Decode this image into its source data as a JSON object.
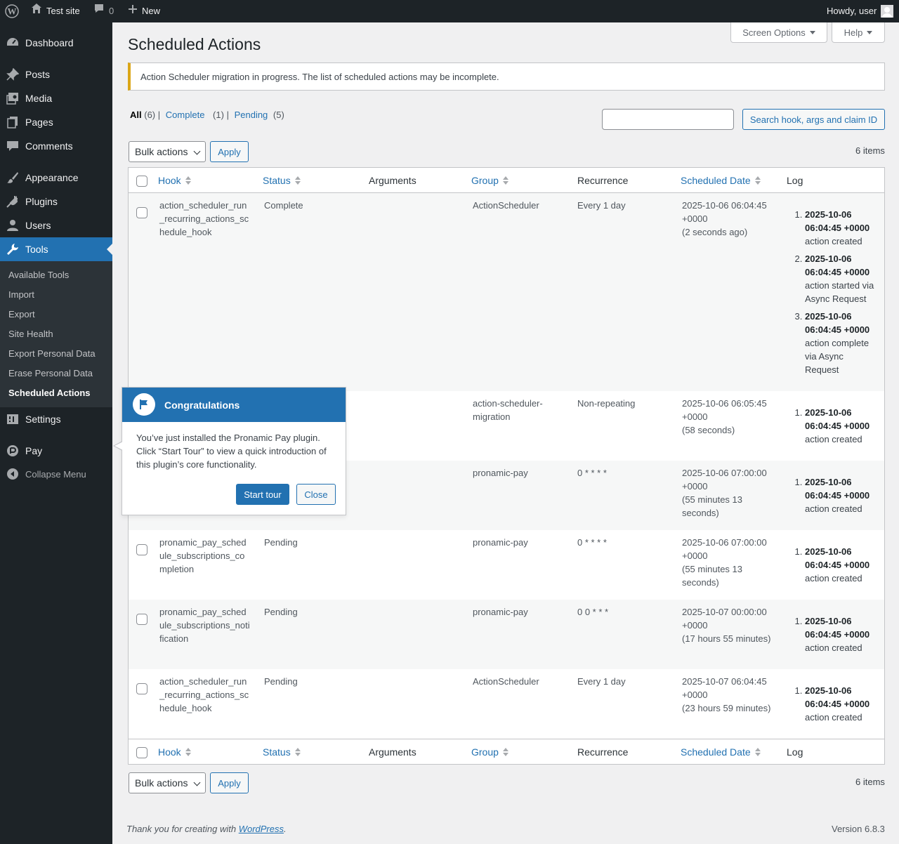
{
  "admin_bar": {
    "site_name": "Test site",
    "comments_count": "0",
    "new_label": "New",
    "howdy": "Howdy, user"
  },
  "sidebar": {
    "items": [
      {
        "label": "Dashboard",
        "icon": "dashboard-icon"
      },
      {
        "label": "Posts",
        "icon": "pin-icon"
      },
      {
        "label": "Media",
        "icon": "media-icon"
      },
      {
        "label": "Pages",
        "icon": "pages-icon"
      },
      {
        "label": "Comments",
        "icon": "comment-icon"
      },
      {
        "label": "Appearance",
        "icon": "brush-icon"
      },
      {
        "label": "Plugins",
        "icon": "plug-icon"
      },
      {
        "label": "Users",
        "icon": "user-icon"
      },
      {
        "label": "Tools",
        "icon": "wrench-icon"
      },
      {
        "label": "Settings",
        "icon": "settings-icon"
      },
      {
        "label": "Pay",
        "icon": "pay-icon"
      },
      {
        "label": "Collapse Menu",
        "icon": "collapse-icon"
      }
    ],
    "submenu": [
      "Available Tools",
      "Import",
      "Export",
      "Site Health",
      "Export Personal Data",
      "Erase Personal Data",
      "Scheduled Actions"
    ]
  },
  "screen_options": "Screen Options",
  "help": "Help",
  "page_title": "Scheduled Actions",
  "notice": "Action Scheduler migration in progress. The list of scheduled actions may be incomplete.",
  "filters": {
    "all": "All",
    "all_count": "(6)",
    "complete": "Complete",
    "complete_count": "(1)",
    "pending": "Pending",
    "pending_count": "(5)",
    "sep": "|"
  },
  "search_button": "Search hook, args and claim ID",
  "bulk_actions": "Bulk actions",
  "apply": "Apply",
  "items_count": "6 items",
  "columns": {
    "hook": "Hook",
    "status": "Status",
    "arguments": "Arguments",
    "group": "Group",
    "recurrence": "Recurrence",
    "scheduled_date": "Scheduled Date",
    "log": "Log"
  },
  "rows": [
    {
      "hook": "action_scheduler_run\n_recurring_actions_sc\nhedule_hook",
      "status": "Complete",
      "group": "ActionScheduler",
      "recurrence": "Every 1 day",
      "date": "2025-10-06 06:04:45\n+0000\n(2 seconds ago)",
      "log": [
        {
          "time": "2025-10-06\n06:04:45 +0000",
          "msg": "action created"
        },
        {
          "time": "2025-10-06\n06:04:45 +0000",
          "msg": "action started via\nAsync Request"
        },
        {
          "time": "2025-10-06\n06:04:45 +0000",
          "msg": "action complete\nvia Async\nRequest"
        }
      ]
    },
    {
      "hook": "",
      "status": "",
      "group": "action-scheduler-\nmigration",
      "recurrence": "Non-repeating",
      "date": "2025-10-06 06:05:45\n+0000\n(58 seconds)",
      "log": [
        {
          "time": "2025-10-06\n06:04:45 +0000",
          "msg": "action created"
        }
      ]
    },
    {
      "hook": "",
      "status": "",
      "group": "pronamic-pay",
      "recurrence": "0 * * * *",
      "date": "2025-10-06 07:00:00\n+0000\n(55 minutes 13\nseconds)",
      "log": [
        {
          "time": "2025-10-06\n06:04:45 +0000",
          "msg": "action created"
        }
      ]
    },
    {
      "hook": "pronamic_pay_sched\nule_subscriptions_co\nmpletion",
      "status": "Pending",
      "group": "pronamic-pay",
      "recurrence": "0 * * * *",
      "date": "2025-10-06 07:00:00\n+0000\n(55 minutes 13\nseconds)",
      "log": [
        {
          "time": "2025-10-06\n06:04:45 +0000",
          "msg": "action created"
        }
      ]
    },
    {
      "hook": "pronamic_pay_sched\nule_subscriptions_noti\nfication",
      "status": "Pending",
      "group": "pronamic-pay",
      "recurrence": "0 0 * * *",
      "date": "2025-10-07 00:00:00\n+0000\n(17 hours 55 minutes)",
      "log": [
        {
          "time": "2025-10-06\n06:04:45 +0000",
          "msg": "action created"
        }
      ]
    },
    {
      "hook": "action_scheduler_run\n_recurring_actions_sc\nhedule_hook",
      "status": "Pending",
      "group": "ActionScheduler",
      "recurrence": "Every 1 day",
      "date": "2025-10-07 06:04:45\n+0000\n(23 hours 59 minutes)",
      "log": [
        {
          "time": "2025-10-06\n06:04:45 +0000",
          "msg": "action created"
        }
      ]
    }
  ],
  "pointer": {
    "title": "Congratulations",
    "body": "You’ve just installed the Pronamic Pay plugin. Click “Start Tour” to view a quick introduction of this plugin’s core functionality.",
    "start": "Start tour",
    "close": "Close"
  },
  "footer": {
    "thanks_prefix": "Thank you for creating with ",
    "link": "WordPress",
    "thanks_suffix": ".",
    "version": "Version 6.8.3"
  },
  "colors": {
    "accent": "#2271b1",
    "admin_bar": "#1d2327",
    "notice_warning": "#dba617"
  }
}
